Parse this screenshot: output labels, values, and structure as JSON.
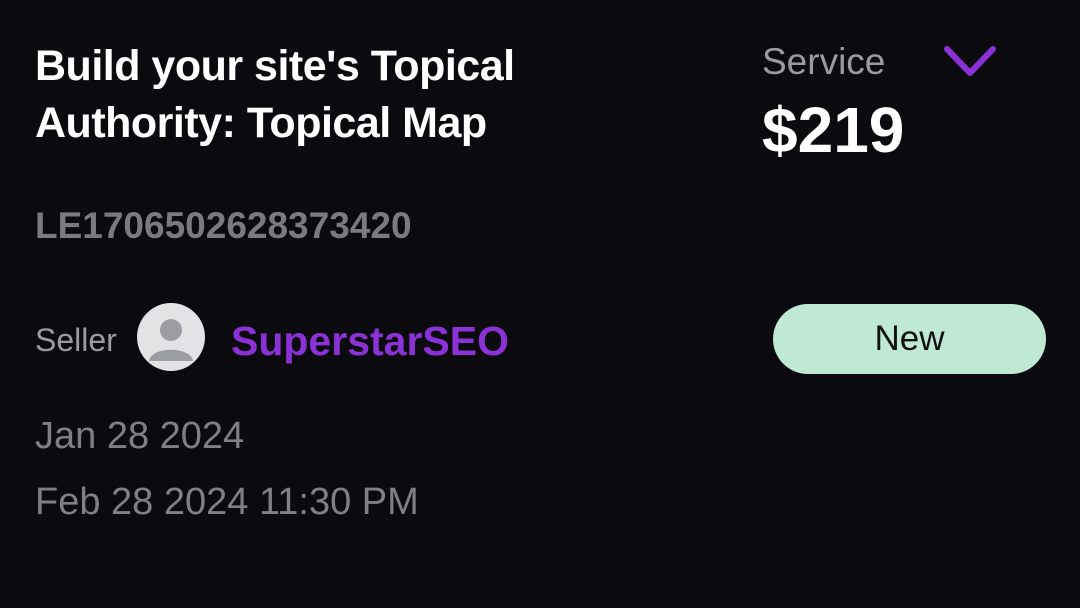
{
  "order": {
    "title": "Build your site's Topical Authority: Topical Map",
    "type_label": "Service",
    "price": "$219",
    "order_id": "LE1706502628373420",
    "seller_label": "Seller",
    "seller_name": "SuperstarSEO",
    "status": "New",
    "start_date": "Jan 28 2024",
    "end_date": "Feb 28 2024 11:30 PM"
  },
  "icons": {
    "expand": "chevron-down-icon",
    "avatar": "user-avatar-icon"
  },
  "colors": {
    "background": "#0b0b0f",
    "accent": "#8a32d6",
    "status_badge": "#bfe8d5",
    "muted_text": "#7f7f84"
  }
}
